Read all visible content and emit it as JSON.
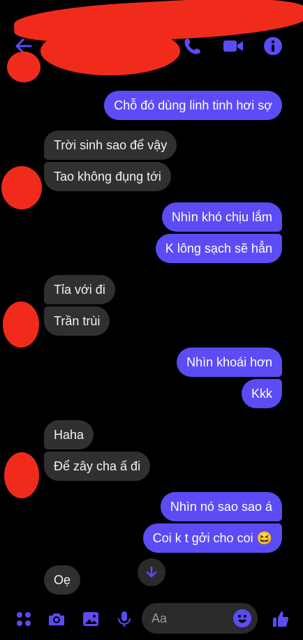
{
  "messages": [
    {
      "text": "Chỗ đó dùng linh tinh hơi sợ"
    },
    {
      "text": "Trời sinh sao để vậy"
    },
    {
      "text": "Tao không đụng tới"
    },
    {
      "text": "Nhìn khó chịu lắm"
    },
    {
      "text": "K lông sạch sẽ hẳn"
    },
    {
      "text": "Tỉa với đi"
    },
    {
      "text": "Trần trùi"
    },
    {
      "text": "Nhìn khoái hơn"
    },
    {
      "text": "Kkk"
    },
    {
      "text": "Haha"
    },
    {
      "text": "Để zây cha ấ đi"
    },
    {
      "text": "Nhìn nó sao sao á"
    },
    {
      "text": "Coi k t gởi cho coi 😆"
    },
    {
      "text": "Oẹ"
    }
  ],
  "composer": {
    "placeholder": "Aa"
  },
  "colors": {
    "accent": "#5b4cf5",
    "incoming": "#303030",
    "redaction": "#f02b1c"
  },
  "icons": [
    "back-arrow-icon",
    "phone-icon",
    "video-camera-icon",
    "info-icon",
    "scroll-down-arrow-icon",
    "apps-grid-icon",
    "camera-icon",
    "gallery-icon",
    "microphone-icon",
    "emoji-icon",
    "thumbs-up-icon"
  ]
}
